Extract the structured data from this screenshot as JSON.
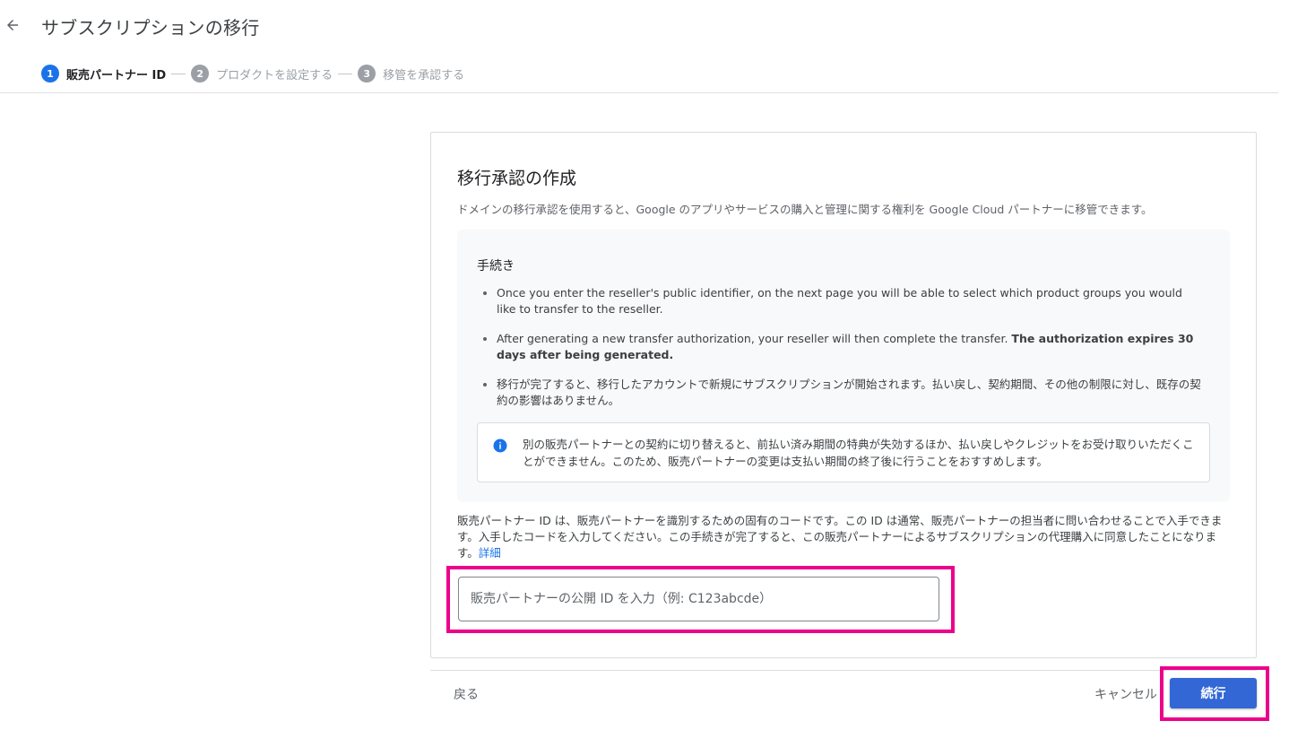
{
  "header": {
    "title": "サブスクリプションの移行"
  },
  "stepper": {
    "steps": [
      {
        "number": "1",
        "label": "販売パートナー ID",
        "state": "active"
      },
      {
        "number": "2",
        "label": "プロダクトを設定する",
        "state": "inactive"
      },
      {
        "number": "3",
        "label": "移管を承認する",
        "state": "inactive"
      }
    ]
  },
  "card": {
    "title": "移行承認の作成",
    "description": "ドメインの移行承認を使用すると、Google のアプリやサービスの購入と管理に関する権利を Google Cloud パートナーに移管できます。",
    "procedure": {
      "title": "手続き",
      "items": [
        "Once you enter the reseller's public identifier, on the next page you will be able to select which product groups you would like to transfer to the reseller.",
        "移行が完了すると、移行したアカウントで新規にサブスクリプションが開始されます。払い戻し、契約期間、その他の制限に対し、既存の契約の影響はありません。"
      ],
      "item2_prefix": "After generating a new transfer authorization, your reseller will then complete the transfer. ",
      "item2_bold": "The authorization expires 30 days after being generated."
    },
    "info": {
      "text": "別の販売パートナーとの契約に切り替えると、前払い済み期間の特典が失効するほか、払い戻しやクレジットをお受け取りいただくことができません。このため、販売パートナーの変更は支払い期間の終了後に行うことをおすすめします。"
    },
    "reseller": {
      "description": "販売パートナー ID は、販売パートナーを識別するための固有のコードです。この ID は通常、販売パートナーの担当者に問い合わせることで入手できます。入手したコードを入力してください。この手続きが完了すると、この販売パートナーによるサブスクリプションの代理購入に同意したことになります。",
      "link": "詳細",
      "input_placeholder": "販売パートナーの公開 ID を入力（例: C123abcde）",
      "input_value": ""
    }
  },
  "footer": {
    "back_label": "戻る",
    "cancel_label": "キャンセル",
    "continue_label": "続行"
  },
  "colors": {
    "primary": "#1a73e8",
    "button": "#3367d6",
    "highlight": "#ec008c",
    "inactive_step": "#9aa0a6"
  }
}
